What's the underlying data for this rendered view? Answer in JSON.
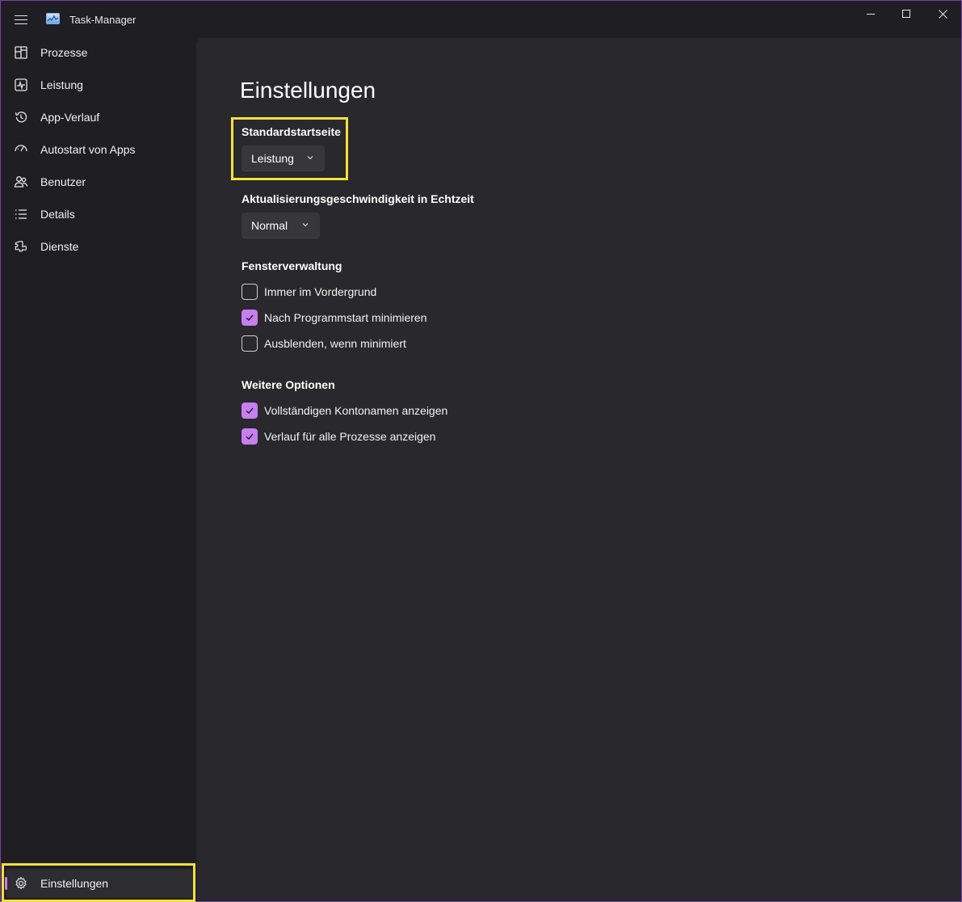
{
  "app": {
    "title": "Task-Manager",
    "accent_color": "#c67ff0",
    "window_border_color": "#7b3fb0",
    "highlight_color": "#f5e13a"
  },
  "titlebar": {
    "menu_icon": "hamburger-icon",
    "controls": [
      "minimize-icon",
      "maximize-icon",
      "close-icon"
    ]
  },
  "sidebar": {
    "items": [
      {
        "label": "Prozesse",
        "icon": "processes-icon"
      },
      {
        "label": "Leistung",
        "icon": "performance-icon"
      },
      {
        "label": "App-Verlauf",
        "icon": "history-icon"
      },
      {
        "label": "Autostart von Apps",
        "icon": "startup-icon"
      },
      {
        "label": "Benutzer",
        "icon": "users-icon"
      },
      {
        "label": "Details",
        "icon": "details-icon"
      },
      {
        "label": "Dienste",
        "icon": "services-icon"
      }
    ],
    "settings": {
      "label": "Einstellungen",
      "icon": "gear-icon",
      "selected": true
    }
  },
  "main": {
    "title": "Einstellungen",
    "default_page": {
      "label": "Standardstartseite",
      "value": "Leistung"
    },
    "update_speed": {
      "label": "Aktualisierungsgeschwindigkeit in Echtzeit",
      "value": "Normal"
    },
    "window_management": {
      "label": "Fensterverwaltung",
      "options": [
        {
          "label": "Immer im Vordergrund",
          "checked": false
        },
        {
          "label": "Nach Programmstart minimieren",
          "checked": true
        },
        {
          "label": "Ausblenden, wenn minimiert",
          "checked": false
        }
      ]
    },
    "more_options": {
      "label": "Weitere Optionen",
      "options": [
        {
          "label": "Vollständigen Kontonamen anzeigen",
          "checked": true
        },
        {
          "label": "Verlauf für alle Prozesse anzeigen",
          "checked": true
        }
      ]
    }
  }
}
